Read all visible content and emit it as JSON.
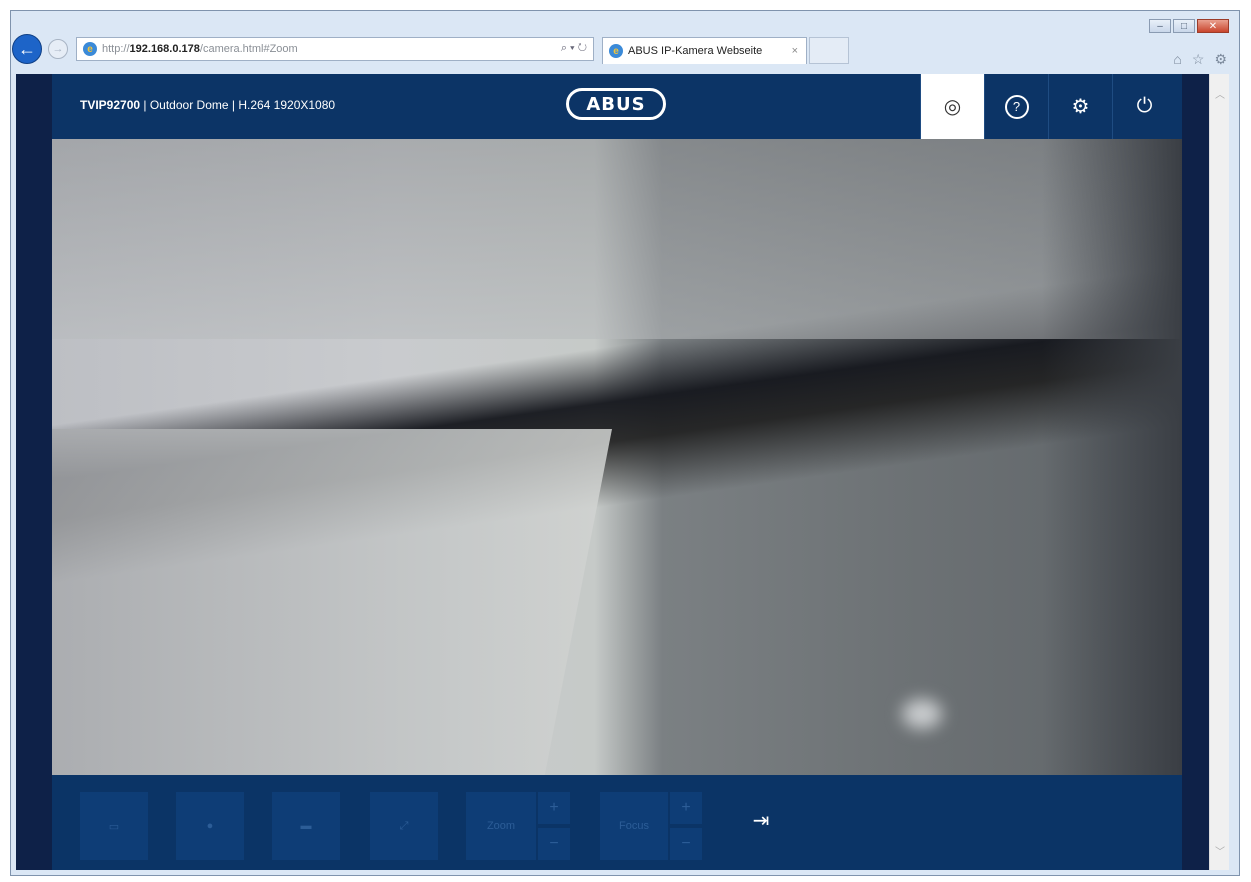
{
  "browser": {
    "url_prefix": "http://",
    "url_host": "192.168.0.178",
    "url_path": "/camera.html#Zoom",
    "address_tools": "⌕ ▾ ↻",
    "tab_title": "ABUS IP-Kamera Webseite",
    "tab_close": "×",
    "window_controls": {
      "minimize": "–",
      "maximize": "□",
      "close": "✕"
    },
    "right_icons": {
      "home": "⌂",
      "favorites": "☆",
      "settings": "⚙"
    }
  },
  "app": {
    "model": "TVIP92700",
    "camera_info": " | Outdoor Dome | H.264 1920X1080",
    "logo_text": "ABUS",
    "header_buttons": [
      {
        "name": "live-view",
        "icon": "◎"
      },
      {
        "name": "help",
        "icon": "?"
      },
      {
        "name": "settings",
        "icon": "⚙"
      },
      {
        "name": "logout",
        "icon": "⏻"
      }
    ],
    "control_buttons": {
      "zoom_label": "Zoom",
      "focus_label": "Focus",
      "plus": "+",
      "minus": "−",
      "exit_icon": "⇥"
    }
  },
  "colors": {
    "header_bg": "#0c3466",
    "controls_bg": "#0b3466",
    "outer_bg": "#0e2148",
    "active_tab_bg": "#ffffff"
  }
}
